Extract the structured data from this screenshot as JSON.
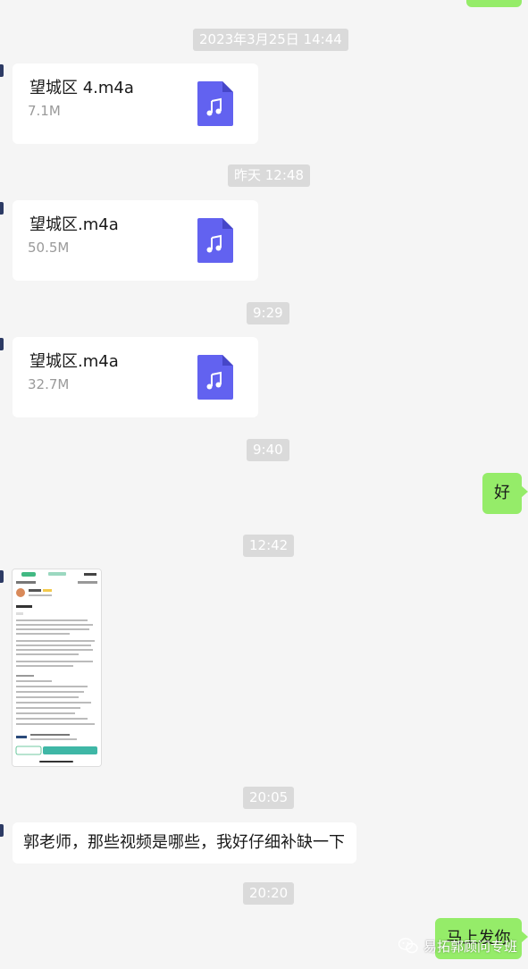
{
  "timestamps": {
    "t1": "2023年3月25日 14:44",
    "t2": "昨天 12:48",
    "t3": "9:29",
    "t4": "9:40",
    "t5": "12:42",
    "t6": "20:05",
    "t7": "20:20"
  },
  "files": [
    {
      "name": "望城区 4.m4a",
      "size": "7.1M"
    },
    {
      "name": "望城区.m4a",
      "size": "50.5M"
    },
    {
      "name": "望城区.m4a",
      "size": "32.7M"
    }
  ],
  "messages": {
    "reply_ok": "好",
    "question": "郭老师，那些视频是哪些，我好仔细补缺一下",
    "reply_soon": "马上发你"
  },
  "watermark": "易拓郭顾问专班",
  "colors": {
    "background": "#f5f5f5",
    "outgoing_bubble": "#95ec69",
    "incoming_bubble": "#ffffff",
    "timestamp_bg": "#dadada",
    "file_icon": "#6262f0"
  }
}
